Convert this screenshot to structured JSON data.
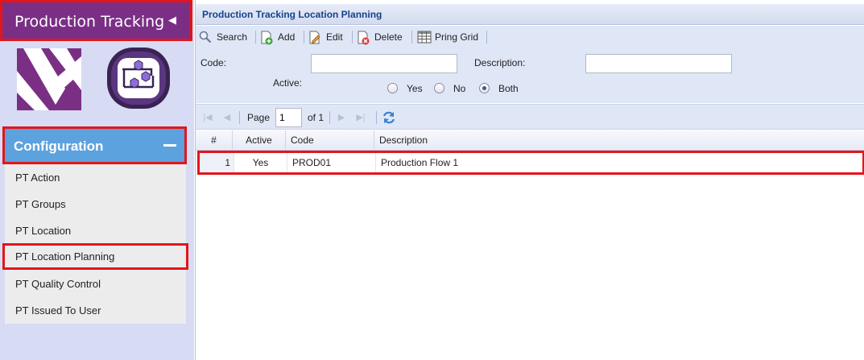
{
  "sidebar": {
    "app_title": "Production Tracking",
    "collapse_glyph": "◀",
    "section_title": "Configuration",
    "items": [
      {
        "label": "PT Action"
      },
      {
        "label": "PT Groups"
      },
      {
        "label": "PT Location"
      },
      {
        "label": "PT Location Planning"
      },
      {
        "label": "PT Quality Control"
      },
      {
        "label": "PT Issued To User"
      }
    ],
    "active_item": "PT Location Planning"
  },
  "panel": {
    "title": "Production Tracking Location Planning"
  },
  "toolbar": {
    "search_label": "Search",
    "add_label": "Add",
    "edit_label": "Edit",
    "delete_label": "Delete",
    "print_label": "Pring Grid"
  },
  "form": {
    "code_label": "Code:",
    "code_value": "",
    "description_label": "Description:",
    "description_value": "",
    "active_label": "Active:",
    "options": [
      {
        "label": "Yes",
        "selected": false
      },
      {
        "label": "No",
        "selected": false
      },
      {
        "label": "Both",
        "selected": true
      }
    ]
  },
  "pager": {
    "page_label": "Page",
    "page_value": "1",
    "of_label": "of 1"
  },
  "grid": {
    "columns": [
      "#",
      "Active",
      "Code",
      "Description"
    ],
    "rows": [
      {
        "num": "1",
        "active": "Yes",
        "code": "PROD01",
        "description": "Production Flow 1"
      }
    ]
  },
  "colors": {
    "brand_purple": "#7a2f85",
    "config_blue": "#5ca2de",
    "highlight_red": "#e3151b",
    "title_blue": "#15428b"
  },
  "icons": [
    "collapse-arrow-icon",
    "app-logo-icon",
    "planning-app-icon",
    "minus-icon",
    "search-icon",
    "add-icon",
    "edit-icon",
    "delete-icon",
    "grid-icon",
    "first-page-icon",
    "prev-page-icon",
    "next-page-icon",
    "last-page-icon",
    "refresh-icon"
  ]
}
